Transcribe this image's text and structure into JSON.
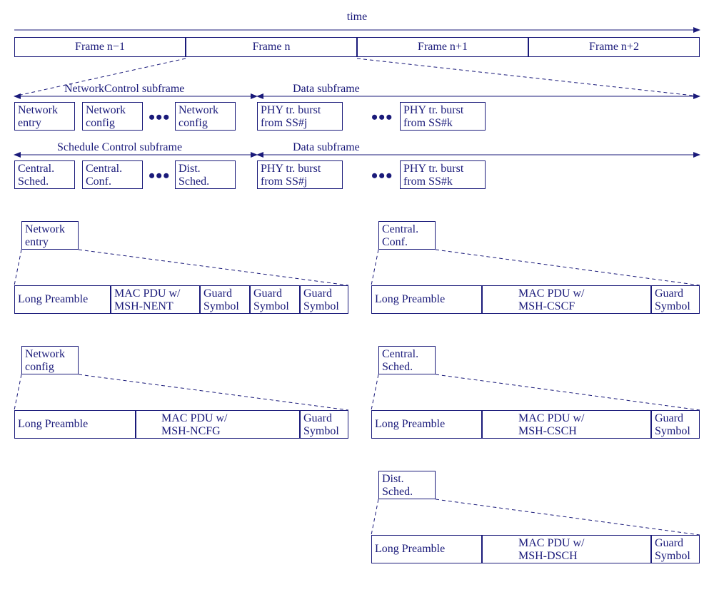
{
  "time_label": "time",
  "frames": [
    "Frame n−1",
    "Frame n",
    "Frame n+1",
    "Frame n+2"
  ],
  "row1": {
    "left_label": "NetworkControl subframe",
    "right_label": "Data subframe",
    "boxes": [
      "Network\nentry",
      "Network\nconfig",
      "Network\nconfig",
      "PHY tr. burst\nfrom SS#j",
      "PHY tr. burst\nfrom SS#k"
    ]
  },
  "row2": {
    "left_label": "Schedule Control subframe",
    "right_label": "Data subframe",
    "boxes": [
      "Central.\nSched.",
      "Central.\nConf.",
      "Dist.\nSched.",
      "PHY tr. burst\nfrom SS#j",
      "PHY tr. burst\nfrom SS#k"
    ]
  },
  "left_details": [
    {
      "header": "Network\nentry",
      "cells": [
        "Long Preamble",
        "MAC PDU w/\nMSH-NENT",
        "Guard\nSymbol",
        "Guard\nSymbol",
        "Guard\nSymbol"
      ]
    },
    {
      "header": "Network\nconfig",
      "cells": [
        "Long Preamble",
        "MAC PDU w/\nMSH-NCFG",
        "Guard\nSymbol"
      ]
    }
  ],
  "right_details": [
    {
      "header": "Central.\nConf.",
      "cells": [
        "Long Preamble",
        "MAC PDU w/\nMSH-CSCF",
        "Guard\nSymbol"
      ]
    },
    {
      "header": "Central.\nSched.",
      "cells": [
        "Long Preamble",
        "MAC PDU w/\nMSH-CSCH",
        "Guard\nSymbol"
      ]
    },
    {
      "header": "Dist.\nSched.",
      "cells": [
        "Long Preamble",
        "MAC PDU w/\nMSH-DSCH",
        "Guard\nSymbol"
      ]
    }
  ]
}
